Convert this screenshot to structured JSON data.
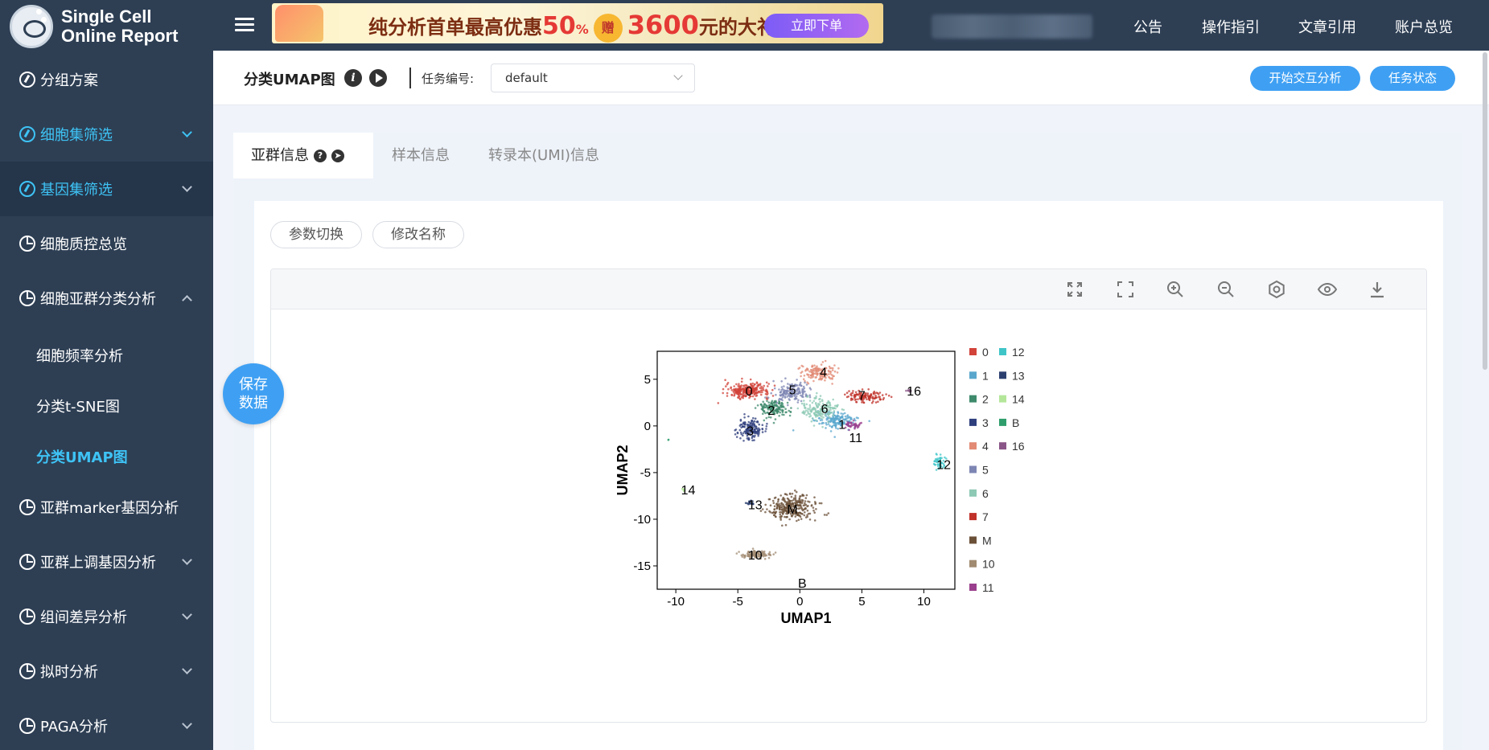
{
  "app": {
    "logo_line1": "Single Cell",
    "logo_line2": "Online Report"
  },
  "banner": {
    "text_before": "纯分析首单最高优惠",
    "discount": "50",
    "pct": "%",
    "gift": "赠",
    "amount": "3600",
    "text_after": "元的大礼包!",
    "button": "立即下单"
  },
  "top_nav": [
    "公告",
    "操作指引",
    "文章引用",
    "账户总览"
  ],
  "sidebar": {
    "items": [
      {
        "label": "分组方案",
        "icon": "compass-icon"
      },
      {
        "label": "细胞集筛选",
        "icon": "compass-icon"
      },
      {
        "label": "基因集筛选",
        "icon": "compass-icon"
      },
      {
        "label": "细胞质控总览",
        "icon": "pie-chart-icon"
      },
      {
        "label": "细胞亚群分类分析",
        "icon": "pie-chart-icon"
      },
      {
        "label": "亚群marker基因分析",
        "icon": "pie-chart-icon"
      },
      {
        "label": "亚群上调基因分析",
        "icon": "pie-chart-icon"
      },
      {
        "label": "组间差异分析",
        "icon": "pie-chart-icon"
      },
      {
        "label": "拟时分析",
        "icon": "pie-chart-icon"
      },
      {
        "label": "PAGA分析",
        "icon": "pie-chart-icon"
      }
    ],
    "sub_items": [
      "细胞频率分析",
      "分类t-SNE图",
      "分类UMAP图"
    ]
  },
  "save_fab": {
    "line1": "保存",
    "line2": "数据"
  },
  "page": {
    "title": "分类UMAP图",
    "task_label": "任务编号:",
    "task_value": "default",
    "btn_interactive": "开始交互分析",
    "btn_status": "任务状态"
  },
  "tabs": [
    "亚群信息",
    "样本信息",
    "转录本(UMI)信息"
  ],
  "actions": {
    "param_switch": "参数切换",
    "rename": "修改名称"
  },
  "toolbar_icons": [
    "fit-screen-icon",
    "fullscreen-icon",
    "zoom-in-icon",
    "zoom-out-icon",
    "settings-icon",
    "eye-icon",
    "download-icon"
  ],
  "chart_data": {
    "type": "scatter",
    "xlabel": "UMAP1",
    "ylabel": "UMAP2",
    "xlim": [
      -11.5,
      12.5
    ],
    "ylim": [
      -17.5,
      8
    ],
    "xticks": [
      -10,
      -5,
      0,
      5,
      10
    ],
    "yticks": [
      5,
      0,
      -5,
      -10,
      -15
    ],
    "legend_position": "right",
    "clusters": [
      {
        "name": "0",
        "color": "#d2433a",
        "center": [
          -4.2,
          3.8
        ],
        "spread": [
          1.6,
          0.7
        ],
        "n": 260
      },
      {
        "name": "1",
        "color": "#5aa7cd",
        "center": [
          3.0,
          0.6
        ],
        "spread": [
          1.5,
          0.8
        ],
        "n": 170
      },
      {
        "name": "2",
        "color": "#3e8a6c",
        "center": [
          -2.1,
          1.9
        ],
        "spread": [
          1.1,
          0.9
        ],
        "n": 150
      },
      {
        "name": "3",
        "color": "#2f3f7e",
        "center": [
          -4.0,
          -0.3
        ],
        "spread": [
          0.9,
          1.0
        ],
        "n": 150
      },
      {
        "name": "4",
        "color": "#e28a74",
        "center": [
          1.5,
          5.7
        ],
        "spread": [
          1.3,
          0.8
        ],
        "n": 140
      },
      {
        "name": "5",
        "color": "#7d86b3",
        "center": [
          -0.7,
          3.6
        ],
        "spread": [
          1.3,
          0.9
        ],
        "n": 160
      },
      {
        "name": "6",
        "color": "#8dc9b4",
        "center": [
          1.6,
          1.8
        ],
        "spread": [
          1.3,
          1.1
        ],
        "n": 170
      },
      {
        "name": "7",
        "color": "#c0312a",
        "center": [
          5.3,
          3.2
        ],
        "spread": [
          1.3,
          0.6
        ],
        "n": 120
      },
      {
        "name": "M",
        "color": "#6b5038",
        "center": [
          -0.6,
          -8.7
        ],
        "spread": [
          1.8,
          1.2
        ],
        "n": 300
      },
      {
        "name": "10",
        "color": "#a08a70",
        "center": [
          -3.5,
          -13.8
        ],
        "spread": [
          1.1,
          0.35
        ],
        "n": 110
      },
      {
        "name": "11",
        "color": "#9a3f8d",
        "center": [
          4.3,
          0.1
        ],
        "spread": [
          0.6,
          0.4
        ],
        "n": 40
      },
      {
        "name": "12",
        "color": "#3fc5c8",
        "center": [
          11.3,
          -3.9
        ],
        "spread": [
          0.4,
          0.7
        ],
        "n": 50
      },
      {
        "name": "13",
        "color": "#2c4070",
        "center": [
          -4.0,
          -8.3
        ],
        "spread": [
          0.3,
          0.2
        ],
        "n": 18
      },
      {
        "name": "14",
        "color": "#b4e69a",
        "center": [
          -9.4,
          -6.8
        ],
        "spread": [
          0.15,
          0.15
        ],
        "n": 8
      },
      {
        "name": "B",
        "color": "#2f9e6c",
        "center": [
          -10.6,
          -1.5
        ],
        "spread": [
          0.05,
          0.05
        ],
        "n": 2
      },
      {
        "name": "16",
        "color": "#8a5587",
        "center": [
          8.8,
          3.8
        ],
        "spread": [
          0.2,
          0.1
        ],
        "n": 8
      }
    ],
    "labels": [
      {
        "text": "0",
        "x": -4.1,
        "y": 3.8
      },
      {
        "text": "5",
        "x": -0.6,
        "y": 3.9
      },
      {
        "text": "4",
        "x": 1.9,
        "y": 5.8
      },
      {
        "text": "7",
        "x": 5.0,
        "y": 3.3
      },
      {
        "text": "16",
        "x": 9.2,
        "y": 3.8
      },
      {
        "text": "2",
        "x": -2.3,
        "y": 1.7
      },
      {
        "text": "6",
        "x": 2.0,
        "y": 1.9
      },
      {
        "text": "1",
        "x": 3.4,
        "y": 0.2
      },
      {
        "text": "11",
        "x": 4.5,
        "y": -1.2
      },
      {
        "text": "3",
        "x": -4.0,
        "y": -0.5
      },
      {
        "text": "12",
        "x": 11.6,
        "y": -4.1
      },
      {
        "text": "14",
        "x": -9.0,
        "y": -6.8
      },
      {
        "text": "13",
        "x": -3.6,
        "y": -8.4
      },
      {
        "text": "M",
        "x": -0.6,
        "y": -8.9
      },
      {
        "text": "10",
        "x": -3.6,
        "y": -13.8
      },
      {
        "text": "B",
        "x": 0.2,
        "y": -16.8
      }
    ],
    "legend_col1": [
      "0",
      "1",
      "2",
      "3",
      "4",
      "5",
      "6",
      "7",
      "M",
      "10",
      "11"
    ],
    "legend_col2": [
      "12",
      "13",
      "14",
      "B",
      "16"
    ]
  }
}
